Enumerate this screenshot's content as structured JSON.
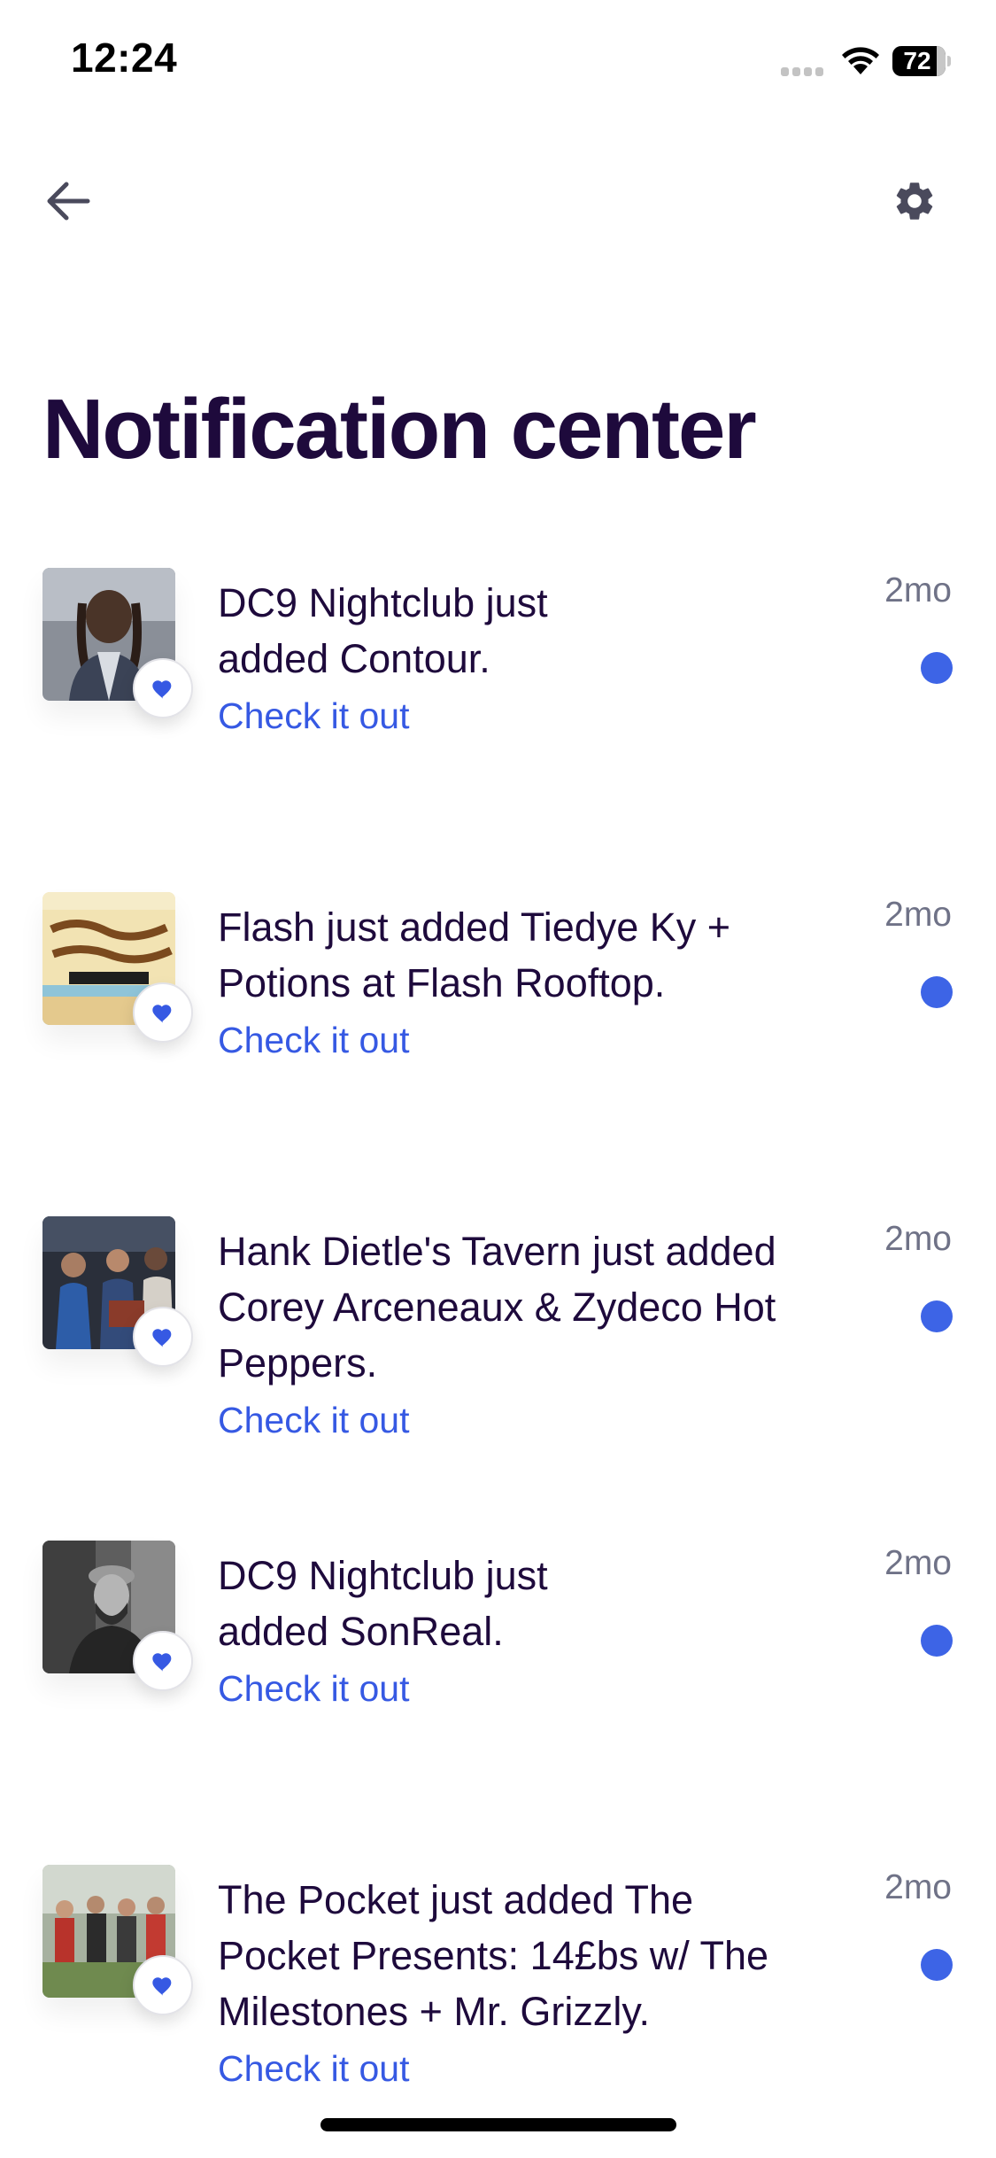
{
  "status_bar": {
    "time": "12:24",
    "battery": "72"
  },
  "nav": {
    "back_icon": "arrow-left-icon",
    "settings_icon": "gear-icon"
  },
  "page": {
    "title": "Notification center"
  },
  "colors": {
    "title": "#1e0a3c",
    "link": "#3659e3",
    "unread_dot": "#3d64e6",
    "time": "#6f7287"
  },
  "notifications": [
    {
      "text": "DC9 Nightclub just added Contour.",
      "link": "Check it out",
      "time": "2mo",
      "unread": true
    },
    {
      "text": "Flash just added Tiedye Ky + Potions at Flash Rooftop.",
      "link": "Check it out",
      "time": "2mo",
      "unread": true
    },
    {
      "text": "Hank Dietle's Tavern just added Corey Arceneaux & Zydeco Hot Peppers.",
      "link": "Check it out",
      "time": "2mo",
      "unread": true
    },
    {
      "text": "DC9 Nightclub just added SonReal.",
      "link": "Check it out",
      "time": "2mo",
      "unread": true
    },
    {
      "text": "The Pocket just added The Pocket Presents: 14£bs w/ The Milestones + Mr. Grizzly.",
      "link": "Check it out",
      "time": "2mo",
      "unread": true
    }
  ]
}
